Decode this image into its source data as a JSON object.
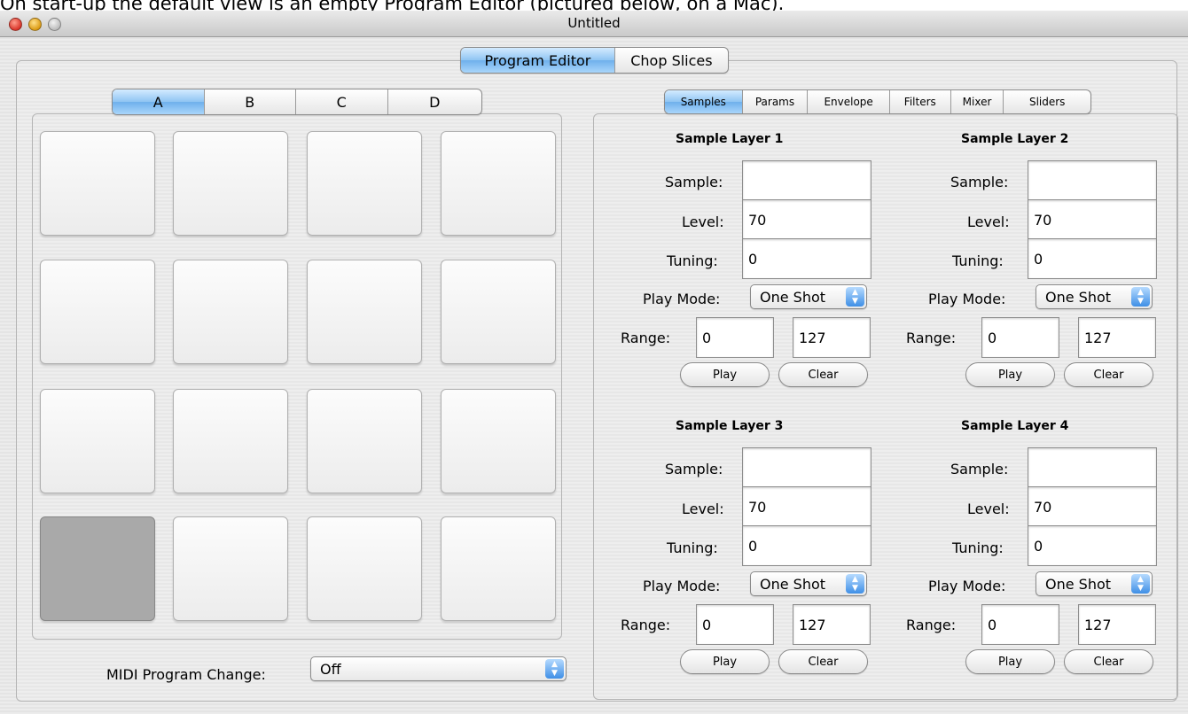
{
  "caption": "On start-up the default view is an empty Program Editor (pictured below, on a Mac).",
  "window": {
    "title": "Untitled"
  },
  "main_tabs": [
    {
      "label": "Program Editor",
      "selected": true
    },
    {
      "label": "Chop Slices",
      "selected": false
    }
  ],
  "bank_tabs": [
    {
      "label": "A",
      "selected": true
    },
    {
      "label": "B",
      "selected": false
    },
    {
      "label": "C",
      "selected": false
    },
    {
      "label": "D",
      "selected": false
    }
  ],
  "pads": {
    "count": 16,
    "selected_index": 12
  },
  "midi": {
    "label": "MIDI Program Change:",
    "value": "Off"
  },
  "editor_tabs": [
    {
      "label": "Samples",
      "selected": true
    },
    {
      "label": "Params",
      "selected": false
    },
    {
      "label": "Envelope",
      "selected": false
    },
    {
      "label": "Filters",
      "selected": false
    },
    {
      "label": "Mixer",
      "selected": false
    },
    {
      "label": "Sliders",
      "selected": false
    }
  ],
  "field_labels": {
    "sample": "Sample:",
    "level": "Level:",
    "tuning": "Tuning:",
    "play_mode": "Play Mode:",
    "range": "Range:"
  },
  "buttons": {
    "play": "Play",
    "clear": "Clear"
  },
  "layers": [
    {
      "title": "Sample Layer 1",
      "sample": "",
      "level": "70",
      "tuning": "0",
      "play_mode": "One Shot",
      "range_low": "0",
      "range_high": "127"
    },
    {
      "title": "Sample Layer 2",
      "sample": "",
      "level": "70",
      "tuning": "0",
      "play_mode": "One Shot",
      "range_low": "0",
      "range_high": "127"
    },
    {
      "title": "Sample Layer 3",
      "sample": "",
      "level": "70",
      "tuning": "0",
      "play_mode": "One Shot",
      "range_low": "0",
      "range_high": "127"
    },
    {
      "title": "Sample Layer 4",
      "sample": "",
      "level": "70",
      "tuning": "0",
      "play_mode": "One Shot",
      "range_low": "0",
      "range_high": "127"
    }
  ]
}
